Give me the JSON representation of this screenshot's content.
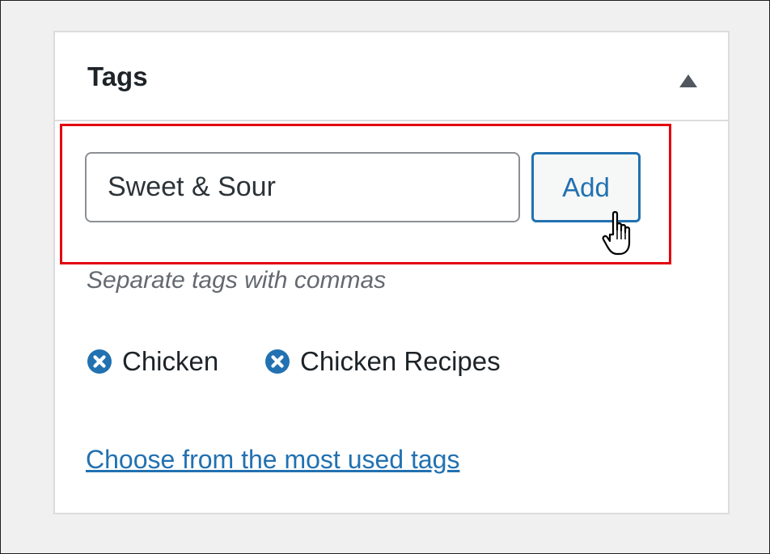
{
  "panel": {
    "title": "Tags",
    "toggle_icon": "triangle-up-icon"
  },
  "tag_input": {
    "value": "Sweet & Sour",
    "placeholder": ""
  },
  "add_button": {
    "label": "Add"
  },
  "howto": "Separate tags with commas",
  "tags": [
    {
      "label": "Chicken",
      "icon": "remove-x-circle-icon"
    },
    {
      "label": "Chicken Recipes",
      "icon": "remove-x-circle-icon"
    }
  ],
  "most_used_link": "Choose from the most used tags",
  "colors": {
    "accent": "#2271b1",
    "highlight_border": "#e3000f",
    "panel_border": "#dcdcde",
    "background": "#f0f0f1"
  }
}
